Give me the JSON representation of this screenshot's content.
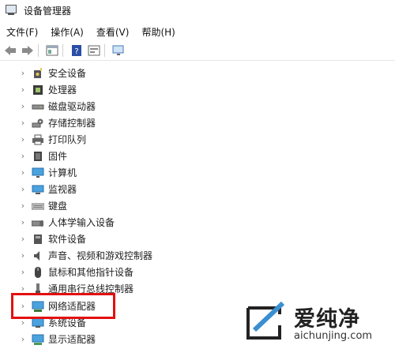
{
  "window": {
    "title": "设备管理器"
  },
  "menu": [
    "文件(F)",
    "操作(A)",
    "查看(V)",
    "帮助(H)"
  ],
  "toolbar": {
    "buttons": [
      "back-arrow-icon",
      "forward-arrow-icon",
      "properties-icon",
      "help-icon",
      "view-icon",
      "monitor-scan-icon"
    ]
  },
  "tree": {
    "items": [
      {
        "label": "安全设备",
        "icon": "security-device-icon"
      },
      {
        "label": "处理器",
        "icon": "processor-icon"
      },
      {
        "label": "磁盘驱动器",
        "icon": "disk-drive-icon"
      },
      {
        "label": "存储控制器",
        "icon": "storage-controller-icon"
      },
      {
        "label": "打印队列",
        "icon": "printer-icon"
      },
      {
        "label": "固件",
        "icon": "firmware-icon"
      },
      {
        "label": "计算机",
        "icon": "computer-icon"
      },
      {
        "label": "监视器",
        "icon": "monitor-icon"
      },
      {
        "label": "键盘",
        "icon": "keyboard-icon"
      },
      {
        "label": "人体学输入设备",
        "icon": "hid-icon"
      },
      {
        "label": "软件设备",
        "icon": "software-device-icon"
      },
      {
        "label": "声音、视频和游戏控制器",
        "icon": "sound-icon"
      },
      {
        "label": "鼠标和其他指针设备",
        "icon": "mouse-icon"
      },
      {
        "label": "通用串行总线控制器",
        "icon": "usb-icon"
      },
      {
        "label": "网络适配器",
        "icon": "network-adapter-icon"
      },
      {
        "label": "系统设备",
        "icon": "system-device-icon"
      },
      {
        "label": "显示适配器",
        "icon": "display-adapter-icon"
      }
    ]
  },
  "highlight": {
    "color": "#e31010",
    "target": "网络适配器"
  },
  "watermark": {
    "text": "爱纯净",
    "url": "aichunjing.com"
  }
}
